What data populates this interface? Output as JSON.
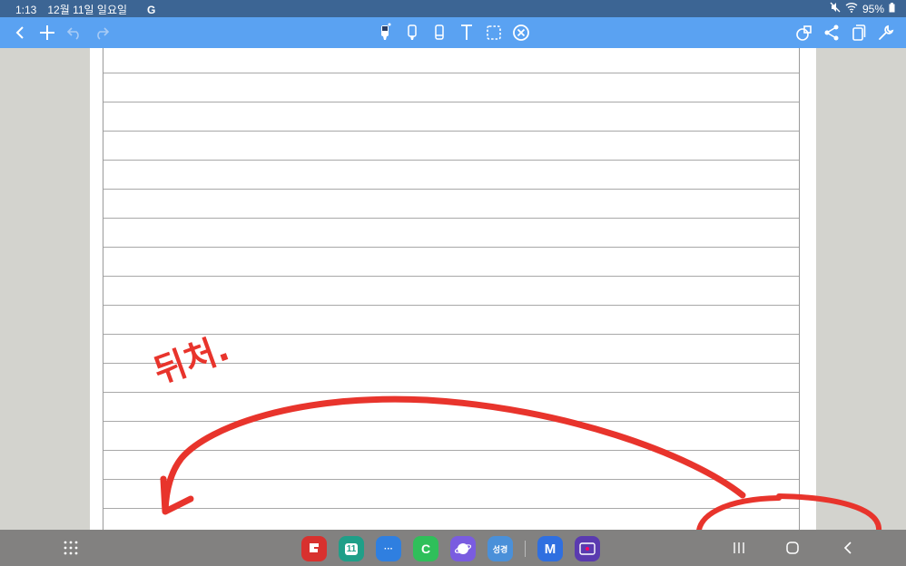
{
  "status_bar": {
    "time": "1:13",
    "date": "12월 11일 일요일",
    "notification": "G",
    "battery": "95%"
  },
  "toolbar": {
    "left_icons": [
      "back-icon",
      "add-icon",
      "undo-icon",
      "redo-icon"
    ],
    "center_tools": [
      "pen-icon",
      "highlighter-icon",
      "eraser-icon",
      "text-icon",
      "selection-icon",
      "clear-icon"
    ],
    "right_icons": [
      "shapes-icon",
      "share-icon",
      "copy-icon",
      "wrench-icon"
    ]
  },
  "annotation": {
    "handwriting": "뒤처.",
    "stroke_color": "#e8342c"
  },
  "taskbar": {
    "apps": [
      {
        "name": "flexcil",
        "label": "",
        "color": "#d8312e"
      },
      {
        "name": "calendar",
        "label": "11",
        "color": "#1f9f88"
      },
      {
        "name": "messages",
        "label": "···",
        "color": "#2f7fe0"
      },
      {
        "name": "phone",
        "label": "C",
        "color": "#2fbf5a"
      },
      {
        "name": "internet",
        "label": "",
        "color": "#7a5ce0"
      },
      {
        "name": "bible",
        "label": "성경",
        "color": "#4a90d9"
      },
      {
        "name": "m-app",
        "label": "M",
        "color": "#2f6fe0"
      },
      {
        "name": "screen-recorder",
        "label": "",
        "color": "#5a3ab0"
      }
    ]
  }
}
